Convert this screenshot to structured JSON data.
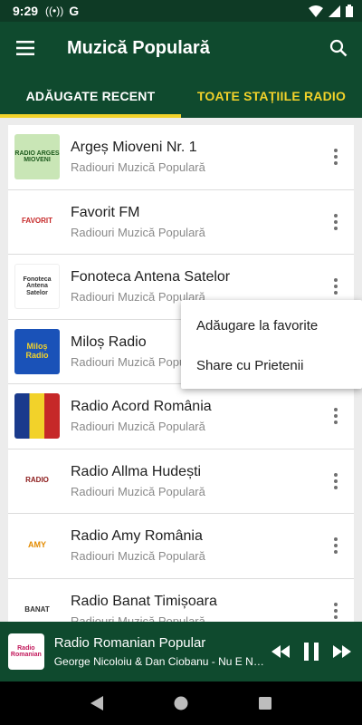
{
  "status": {
    "time": "9:29",
    "carrier_icon": "G"
  },
  "appbar": {
    "title": "Muzică Populară"
  },
  "tabs": [
    {
      "label": "ADĂUGATE RECENT",
      "active": true
    },
    {
      "label": "TOATE STAȚIILE RADIO",
      "active": false
    }
  ],
  "stations": [
    {
      "name": "Argeș Mioveni Nr. 1",
      "category": "Radiouri Muzică Populară",
      "logo_text": "RADIO ARGES MIOVENI"
    },
    {
      "name": "Favorit FM",
      "category": "Radiouri Muzică Populară",
      "logo_text": "FAVORIT"
    },
    {
      "name": "Fonoteca Antena Satelor",
      "category": "Radiouri Muzică Populară",
      "logo_text": "Fonoteca Antena Satelor"
    },
    {
      "name": "Miloș Radio",
      "category": "Radiouri Muzică Popular",
      "logo_text": "Miloș Radio"
    },
    {
      "name": "Radio Acord România",
      "category": "Radiouri Muzică Populară",
      "logo_text": ""
    },
    {
      "name": "Radio Allma Hudești",
      "category": "Radiouri Muzică Populară",
      "logo_text": "RADIO"
    },
    {
      "name": "Radio Amy România",
      "category": "Radiouri Muzică Populară",
      "logo_text": "AMY"
    },
    {
      "name": "Radio Banat Timișoara",
      "category": "Radiouri Muzică Populară",
      "logo_text": "BANAT"
    }
  ],
  "popup_menu": {
    "items": [
      "Adăugare la favorite",
      "Share cu Prietenii"
    ]
  },
  "player": {
    "title": "Radio Romanian Popular",
    "subtitle": "George Nicoloiu & Dan Ciobanu - Nu E Nici...",
    "logo_text": "Radio Romanian"
  },
  "colors": {
    "primary": "#0f4a2e",
    "accent": "#f2d22a",
    "status": "#0e3a25"
  }
}
